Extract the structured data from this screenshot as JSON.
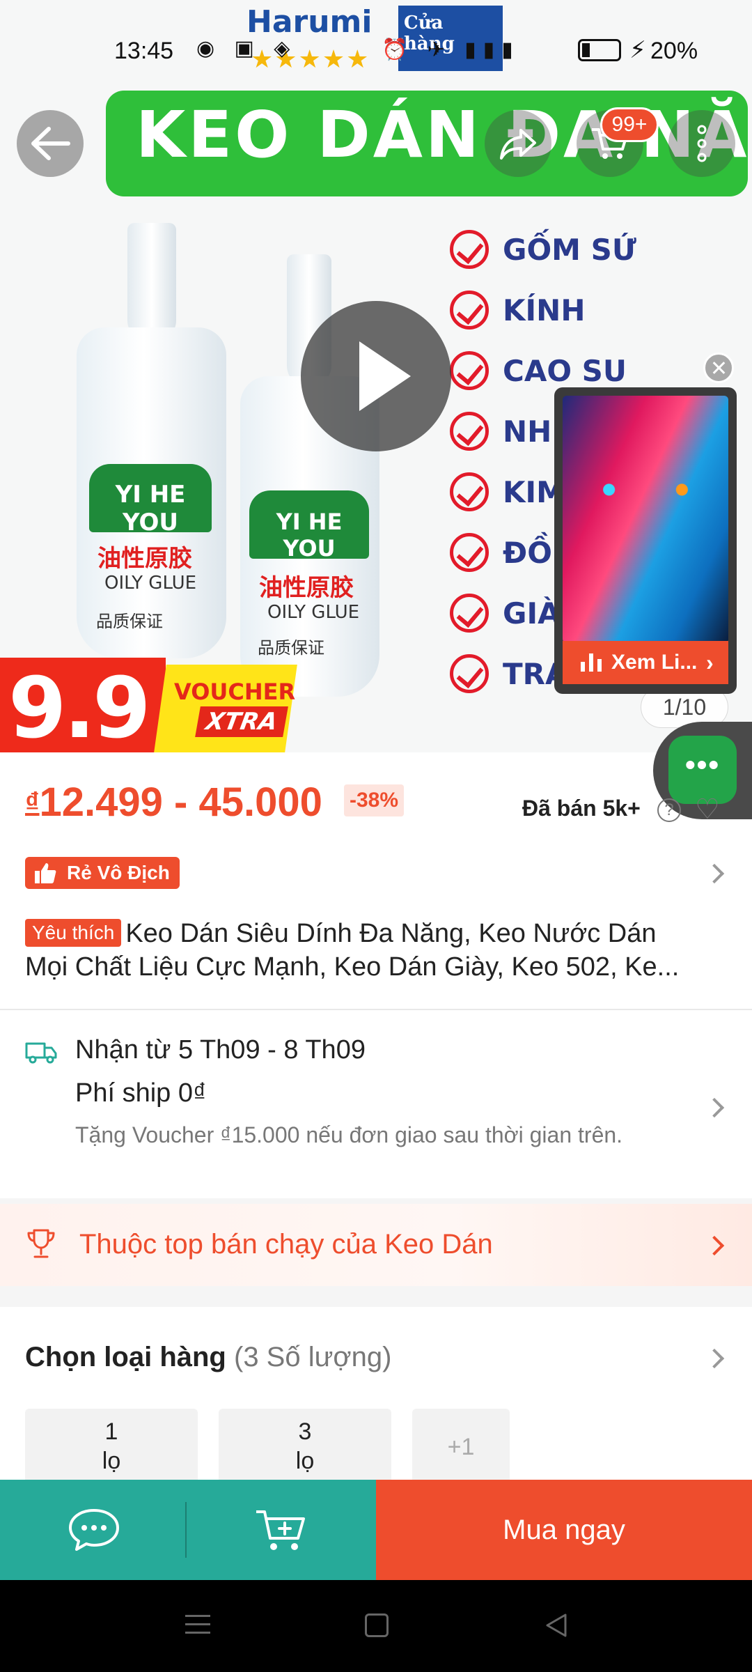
{
  "status_bar": {
    "time": "13:45",
    "battery": "20%"
  },
  "brand": {
    "name": "Harumi",
    "tag": "Cửa hàng"
  },
  "banner": {
    "text": "KEO DÁN ĐA NĂNG"
  },
  "header": {
    "cart_badge": "99+"
  },
  "product_image": {
    "bottle_brand": "YI HE YOU",
    "bottle_red_label": "油性原胶",
    "bottle_sub_label": "OILY GLUE",
    "bottle_quality": "品质保证",
    "materials": [
      "GỐM SỨ",
      "KÍNH",
      "CAO SU",
      "NHỰ",
      "KIM",
      "ĐỒ",
      "GIÀY",
      "TRANG"
    ],
    "voucher_number": "9.9",
    "voucher_word": "VOUCHER",
    "voucher_xtra": "XTRA",
    "counter": "1/10"
  },
  "live_popup": {
    "label": "Xem Li..."
  },
  "chat_float": {
    "label": "•••"
  },
  "price": {
    "currency": "₫",
    "range": "12.499 - 45.000",
    "discount": "-38%",
    "sold": "Đã bán 5k+"
  },
  "badge": {
    "label": "Rẻ Vô Địch"
  },
  "title": {
    "tag": "Yêu thích",
    "line1": "Keo Dán Siêu Dính Đa Năng, Keo Nước Dán",
    "line2": "Mọi Chất Liệu Cực Mạnh, Keo Dán Giày, Keo 502, Ke..."
  },
  "shipping": {
    "date": "Nhận từ 5 Th09 - 8 Th09",
    "fee": "Phí ship 0₫",
    "note": "Tặng Voucher ₫15.000 nếu đơn giao sau thời gian trên."
  },
  "top_seller": {
    "text": "Thuộc top bán chạy của Keo Dán"
  },
  "variants": {
    "title": "Chọn loại hàng",
    "count": "(3 Số lượng)",
    "options": [
      {
        "qty": "1",
        "unit": "lọ"
      },
      {
        "qty": "3",
        "unit": "lọ"
      }
    ],
    "more": "+1"
  },
  "bottom_bar": {
    "buy_now": "Mua ngay"
  },
  "colors": {
    "brand_orange": "#ee4d2d",
    "teal": "#26aa99",
    "green_banner": "#2fbf3a"
  }
}
